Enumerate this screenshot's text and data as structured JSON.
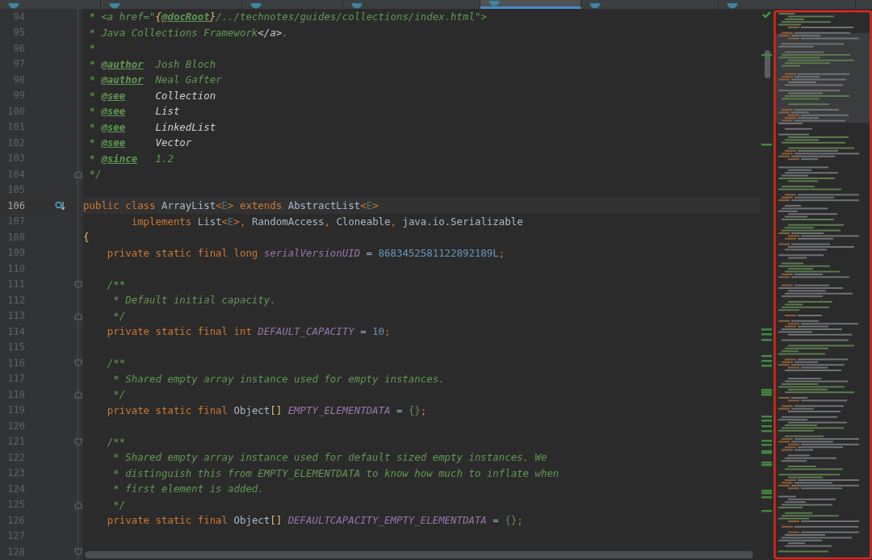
{
  "tabs": [
    {
      "selected": false
    },
    {
      "selected": false
    },
    {
      "selected": false
    },
    {
      "selected": false
    },
    {
      "selected": true
    },
    {
      "selected": false
    },
    {
      "selected": false
    }
  ],
  "editor": {
    "lines": [
      {
        "number": "94",
        "current": false,
        "tokens": [
          {
            "kind": "doc",
            "text": " * <a href=\""
          },
          {
            "kind": "doc-brace",
            "text": "{"
          },
          {
            "kind": "doc-tag",
            "text": "@docRoot"
          },
          {
            "kind": "doc-brace",
            "text": "}"
          },
          {
            "kind": "doc",
            "text": "/../technotes/guides/collections/index.html\">"
          }
        ]
      },
      {
        "number": "95",
        "current": false,
        "tokens": [
          {
            "kind": "doc",
            "text": " * Java Collections Framework"
          },
          {
            "kind": "doc-markup",
            "text": "</a>"
          },
          {
            "kind": "doc",
            "text": "."
          }
        ]
      },
      {
        "number": "96",
        "current": false,
        "tokens": [
          {
            "kind": "doc",
            "text": " *"
          }
        ]
      },
      {
        "number": "97",
        "current": false,
        "tokens": [
          {
            "kind": "doc",
            "text": " * "
          },
          {
            "kind": "doc-tag",
            "text": "@author"
          },
          {
            "kind": "doc",
            "text": "  Josh Bloch"
          }
        ]
      },
      {
        "number": "98",
        "current": false,
        "tokens": [
          {
            "kind": "doc",
            "text": " * "
          },
          {
            "kind": "doc-tag",
            "text": "@author"
          },
          {
            "kind": "doc",
            "text": "  Neal Gafter"
          }
        ]
      },
      {
        "number": "99",
        "current": false,
        "tokens": [
          {
            "kind": "doc",
            "text": " * "
          },
          {
            "kind": "doc-tag",
            "text": "@see"
          },
          {
            "kind": "doc-ref",
            "text": "     Collection"
          }
        ]
      },
      {
        "number": "100",
        "current": false,
        "tokens": [
          {
            "kind": "doc",
            "text": " * "
          },
          {
            "kind": "doc-tag",
            "text": "@see"
          },
          {
            "kind": "doc-ref",
            "text": "     List"
          }
        ]
      },
      {
        "number": "101",
        "current": false,
        "tokens": [
          {
            "kind": "doc",
            "text": " * "
          },
          {
            "kind": "doc-tag",
            "text": "@see"
          },
          {
            "kind": "doc-ref",
            "text": "     LinkedList"
          }
        ]
      },
      {
        "number": "102",
        "current": false,
        "tokens": [
          {
            "kind": "doc",
            "text": " * "
          },
          {
            "kind": "doc-tag",
            "text": "@see"
          },
          {
            "kind": "doc-ref",
            "text": "     Vector"
          }
        ]
      },
      {
        "number": "103",
        "current": false,
        "tokens": [
          {
            "kind": "doc",
            "text": " * "
          },
          {
            "kind": "doc-tag",
            "text": "@since"
          },
          {
            "kind": "doc",
            "text": "   1.2"
          }
        ]
      },
      {
        "number": "104",
        "current": false,
        "kind": "fold-end",
        "tokens": [
          {
            "kind": "doc",
            "text": " */"
          }
        ]
      },
      {
        "number": "105",
        "current": false
      },
      {
        "number": "106",
        "current": true,
        "kind": "implementing",
        "tokens": [
          {
            "kind": "keyword",
            "text": "public class "
          },
          {
            "kind": "plain",
            "text": "ArrayList"
          },
          {
            "kind": "keyword",
            "text": "<"
          },
          {
            "kind": "generic",
            "text": "E"
          },
          {
            "kind": "keyword",
            "text": "> extends "
          },
          {
            "kind": "plain",
            "text": "AbstractList"
          },
          {
            "kind": "keyword",
            "text": "<"
          },
          {
            "kind": "generic",
            "text": "E"
          },
          {
            "kind": "keyword",
            "text": ">"
          }
        ]
      },
      {
        "number": "107",
        "current": false,
        "tokens": [
          {
            "kind": "keyword",
            "text": "        implements "
          },
          {
            "kind": "plain",
            "text": "List"
          },
          {
            "kind": "keyword",
            "text": "<"
          },
          {
            "kind": "generic",
            "text": "E"
          },
          {
            "kind": "keyword",
            "text": ">, "
          },
          {
            "kind": "plain",
            "text": "RandomAccess"
          },
          {
            "kind": "keyword",
            "text": ", "
          },
          {
            "kind": "plain",
            "text": "Cloneable"
          },
          {
            "kind": "keyword",
            "text": ", "
          },
          {
            "kind": "plain",
            "text": "java.io.Serializable"
          }
        ]
      },
      {
        "number": "108",
        "current": false,
        "tokens": [
          {
            "kind": "brace",
            "text": "{"
          }
        ]
      },
      {
        "number": "109",
        "current": false,
        "tokens": [
          {
            "kind": "keyword",
            "text": "    private static final long "
          },
          {
            "kind": "constant",
            "text": "serialVersionUID"
          },
          {
            "kind": "plain",
            "text": " = "
          },
          {
            "kind": "number",
            "text": "8683452581122892189L"
          },
          {
            "kind": "keyword",
            "text": ";"
          }
        ]
      },
      {
        "number": "110",
        "current": false
      },
      {
        "number": "111",
        "current": false,
        "kind": "fold-start",
        "tokens": [
          {
            "kind": "doc",
            "text": "    /**"
          }
        ]
      },
      {
        "number": "112",
        "current": false,
        "tokens": [
          {
            "kind": "doc",
            "text": "     * Default initial capacity."
          }
        ]
      },
      {
        "number": "113",
        "current": false,
        "kind": "fold-end",
        "tokens": [
          {
            "kind": "doc",
            "text": "     */"
          }
        ]
      },
      {
        "number": "114",
        "current": false,
        "tokens": [
          {
            "kind": "keyword",
            "text": "    private static final int "
          },
          {
            "kind": "constant",
            "text": "DEFAULT_CAPACITY"
          },
          {
            "kind": "plain",
            "text": " = "
          },
          {
            "kind": "number",
            "text": "10"
          },
          {
            "kind": "keyword",
            "text": ";"
          }
        ]
      },
      {
        "number": "115",
        "current": false
      },
      {
        "number": "116",
        "current": false,
        "kind": "fold-start",
        "tokens": [
          {
            "kind": "doc",
            "text": "    /**"
          }
        ]
      },
      {
        "number": "117",
        "current": false,
        "tokens": [
          {
            "kind": "doc",
            "text": "     * Shared empty array instance used for empty instances."
          }
        ]
      },
      {
        "number": "118",
        "current": false,
        "kind": "fold-end",
        "tokens": [
          {
            "kind": "doc",
            "text": "     */"
          }
        ]
      },
      {
        "number": "119",
        "current": false,
        "tokens": [
          {
            "kind": "keyword",
            "text": "    private static final "
          },
          {
            "kind": "plain",
            "text": "Object"
          },
          {
            "kind": "brace",
            "text": "[]"
          },
          {
            "kind": "constant",
            "text": " EMPTY_ELEMENTDATA"
          },
          {
            "kind": "plain",
            "text": " = "
          },
          {
            "kind": "literal",
            "text": "{}"
          },
          {
            "kind": "keyword",
            "text": ";"
          }
        ]
      },
      {
        "number": "120",
        "current": false
      },
      {
        "number": "121",
        "current": false,
        "kind": "fold-start",
        "tokens": [
          {
            "kind": "doc",
            "text": "    /**"
          }
        ]
      },
      {
        "number": "122",
        "current": false,
        "tokens": [
          {
            "kind": "doc",
            "text": "     * Shared empty array instance used for default sized empty instances. We"
          }
        ]
      },
      {
        "number": "123",
        "current": false,
        "tokens": [
          {
            "kind": "doc",
            "text": "     * distinguish this from EMPTY_ELEMENTDATA to know how much to inflate when"
          }
        ]
      },
      {
        "number": "124",
        "current": false,
        "tokens": [
          {
            "kind": "doc",
            "text": "     * first element is added."
          }
        ]
      },
      {
        "number": "125",
        "current": false,
        "kind": "fold-end",
        "tokens": [
          {
            "kind": "doc",
            "text": "     */"
          }
        ]
      },
      {
        "number": "126",
        "current": false,
        "tokens": [
          {
            "kind": "keyword",
            "text": "    private static final "
          },
          {
            "kind": "plain",
            "text": "Object"
          },
          {
            "kind": "brace",
            "text": "[]"
          },
          {
            "kind": "constant",
            "text": " DEFAULTCAPACITY_EMPTY_ELEMENTDATA"
          },
          {
            "kind": "plain",
            "text": " = "
          },
          {
            "kind": "literal",
            "text": "{}"
          },
          {
            "kind": "keyword",
            "text": ";"
          }
        ]
      },
      {
        "number": "127",
        "current": false
      },
      {
        "number": "128",
        "current": false,
        "kind": "fold-start"
      }
    ]
  }
}
